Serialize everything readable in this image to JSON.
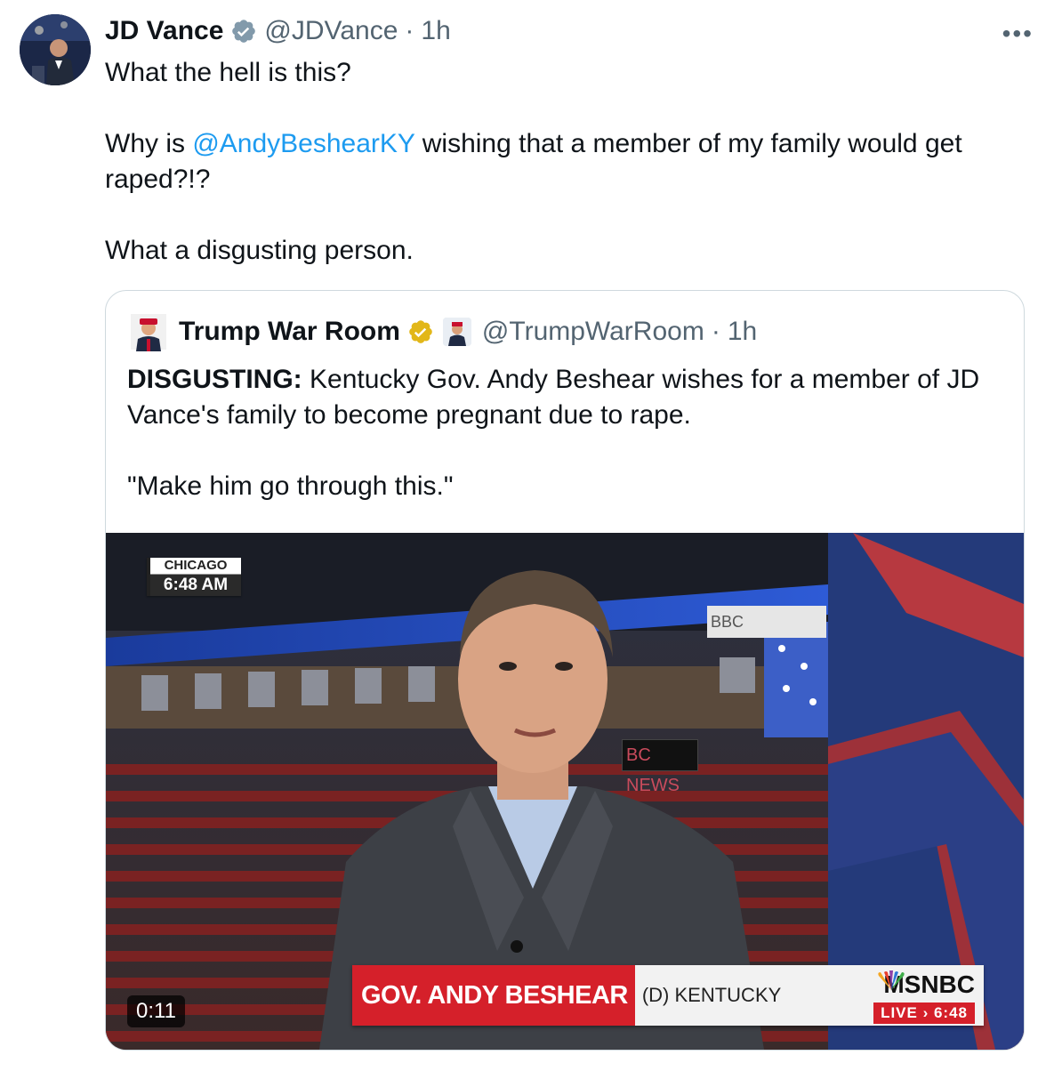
{
  "tweet": {
    "author_name": "JD Vance",
    "handle": "@JDVance",
    "separator": "·",
    "time": "1h",
    "more_label": "•••",
    "line1": "What the hell is this?",
    "line2_prefix": "Why is ",
    "mention": "@AndyBeshearKY",
    "line2_suffix": " wishing that a member of my family would get raped?!?",
    "line3": "What a disgusting person."
  },
  "quote": {
    "author_name": "Trump War Room",
    "handle": "@TrumpWarRoom",
    "separator": "·",
    "time": "1h",
    "bold_lead": "DISGUSTING:",
    "text_rest": " Kentucky Gov. Andy Beshear wishes for a member of JD Vance's family to become pregnant due to rape.",
    "quote_line": "\"Make him go through this.\""
  },
  "video": {
    "city": "CHICAGO",
    "clock": "6:48 AM",
    "lower_third_name": "GOV. ANDY BESHEAR",
    "lower_third_sub": "(D) KENTUCKY",
    "network": "MSNBC",
    "live_text": "LIVE › 6:48",
    "duration": "0:11",
    "bg_sign_1": "BC NEWS",
    "bg_sign_2": "BBC"
  },
  "colors": {
    "link": "#1d9bf0",
    "verified_blue": "#829aab",
    "verified_gold": "#e2b719",
    "msnbc_red": "#d5202a"
  },
  "icons": [
    "verified-badge-icon",
    "gold-verified-badge-icon",
    "more-icon",
    "peacock-icon"
  ]
}
